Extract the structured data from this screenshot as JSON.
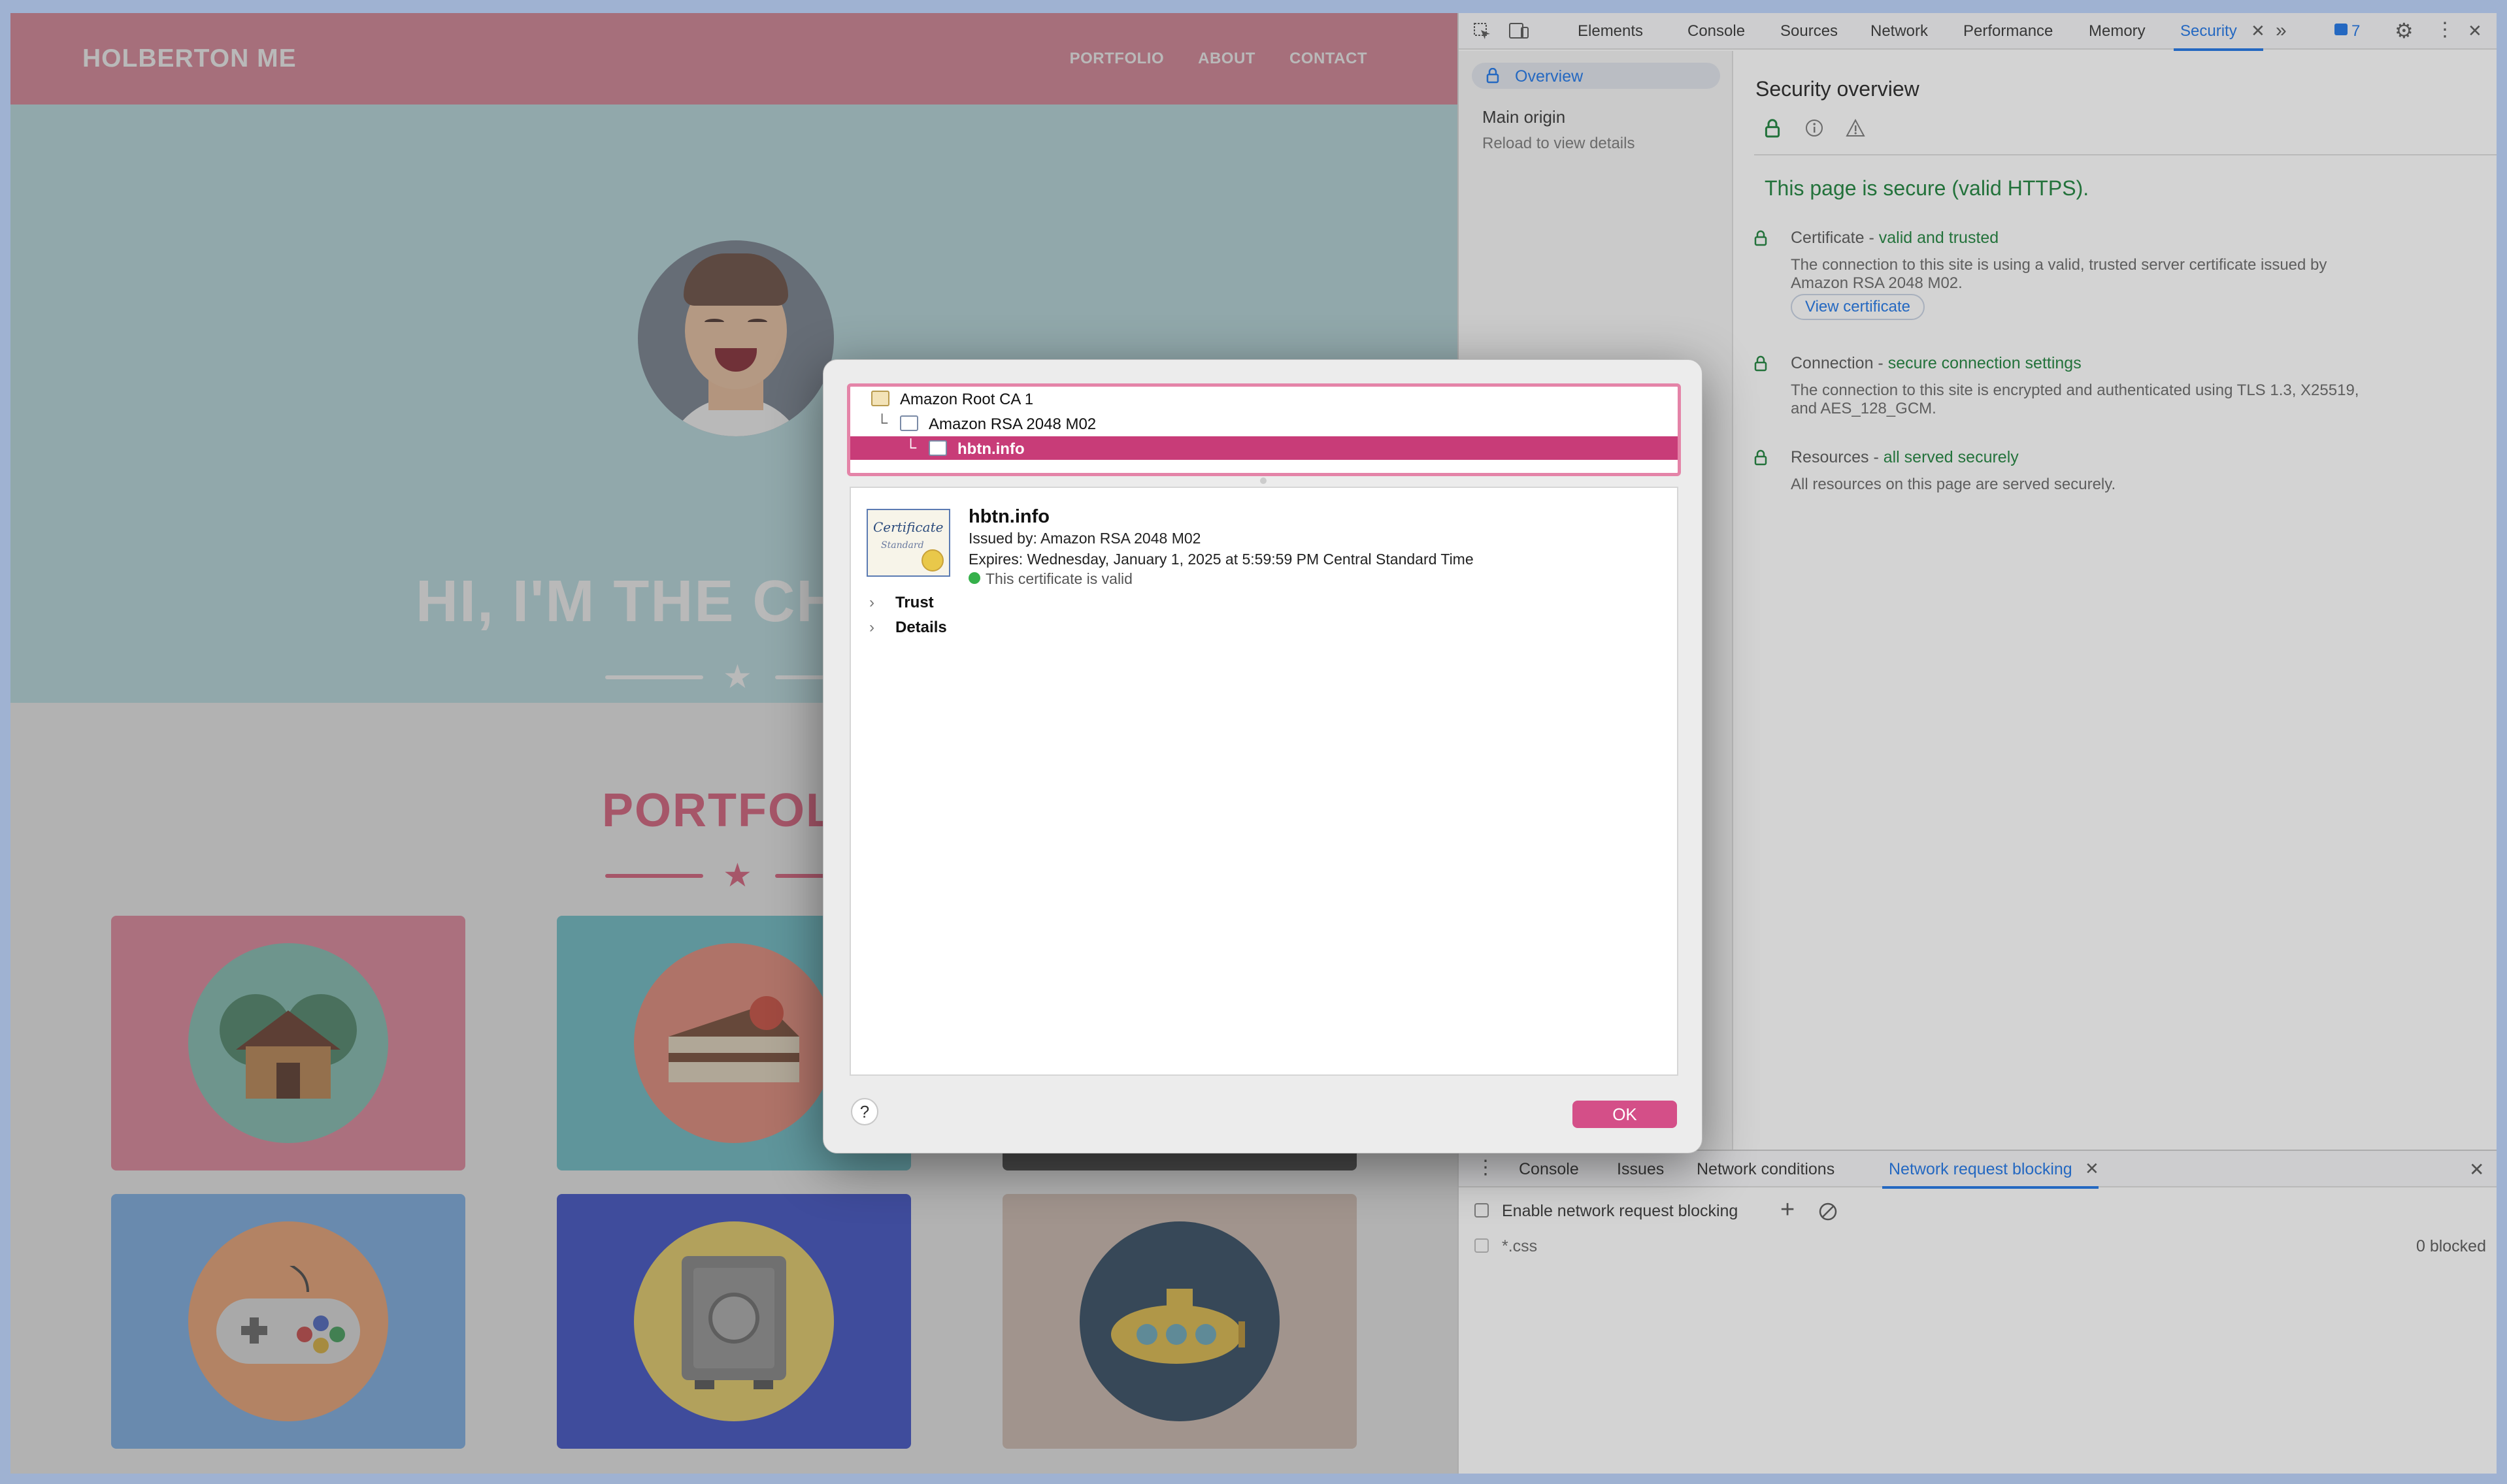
{
  "site": {
    "logo": "HOLBERTON ME",
    "nav": [
      "PORTFOLIO",
      "ABOUT",
      "CONTACT"
    ],
    "hero_title": "HI, I'M THE CH",
    "portfolio_title": "PORTFOL",
    "colors": {
      "nav": "#e0889c",
      "hero": "#bfe4e9",
      "accent": "#e0607e"
    }
  },
  "devtools": {
    "tabs": [
      "Elements",
      "Console",
      "Sources",
      "Network",
      "Performance",
      "Memory",
      "Security"
    ],
    "active_tab": "Security",
    "issues_count": "7",
    "sidebar": {
      "overview": "Overview",
      "main_origin": "Main origin",
      "reload_hint": "Reload to view details"
    },
    "security": {
      "title": "Security overview",
      "status": "This page is secure (valid HTTPS).",
      "certificate_head": "Certificate - ",
      "certificate_status": "valid and trusted",
      "certificate_desc": "The connection to this site is using a valid, trusted server certificate issued by Amazon RSA 2048 M02.",
      "view_certificate": "View certificate",
      "connection_head": "Connection - ",
      "connection_status": "secure connection settings",
      "connection_desc": "The connection to this site is encrypted and authenticated using TLS 1.3, X25519, and AES_128_GCM.",
      "resources_head": "Resources - ",
      "resources_status": "all served securely",
      "resources_desc": "All resources on this page are served securely."
    },
    "drawer": {
      "tabs": [
        "Console",
        "Issues",
        "Network conditions",
        "Network request blocking"
      ],
      "enable_label": "Enable network request blocking",
      "pattern": "*.css",
      "blocked": "0 blocked"
    }
  },
  "dialog": {
    "chain": [
      "Amazon Root CA 1",
      "Amazon RSA 2048 M02",
      "hbtn.info"
    ],
    "cert_image_line1": "Certificate",
    "cert_image_line2": "Standard",
    "common_name": "hbtn.info",
    "issued_by": "Issued by: Amazon RSA 2048 M02",
    "expires": "Expires: Wednesday, January 1, 2025 at 5:59:59 PM Central Standard Time",
    "valid": "This certificate is valid",
    "sections": [
      "Trust",
      "Details"
    ],
    "help": "?",
    "ok": "OK"
  }
}
